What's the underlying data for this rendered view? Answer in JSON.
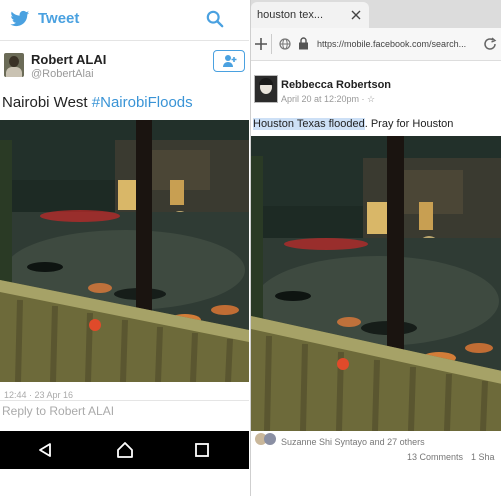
{
  "twitter": {
    "title": "Tweet",
    "author_name": "Robert ALAI",
    "author_handle": "@RobertAlai",
    "tweet_prefix": "Nairobi West ",
    "tweet_hashtag": "#NairobiFloods",
    "timestamp": "12:44 · 23 Apr 16",
    "reply_placeholder": "Reply to Robert ALAI"
  },
  "browser": {
    "tab_title": "houston tex...",
    "url": "https://mobile.facebook.com/search..."
  },
  "facebook": {
    "author_name": "Rebbecca Robertson",
    "post_date": "April 20 at 12:20pm · ☆",
    "post_text_highlight": "Houston Texas flooded",
    "post_text_rest": ". Pray for Houston",
    "likes_text": "Suzanne Shi Syntayo and 27 others",
    "comments_text": "13 Comments",
    "shares_text": "1 Sha"
  },
  "icons": [
    "twitter-bird-icon",
    "search-icon",
    "follow-icon",
    "back-icon",
    "home-icon",
    "recents-icon",
    "close-icon",
    "new-tab-icon",
    "globe-icon",
    "lock-icon",
    "reload-icon",
    "reaction-icon"
  ]
}
